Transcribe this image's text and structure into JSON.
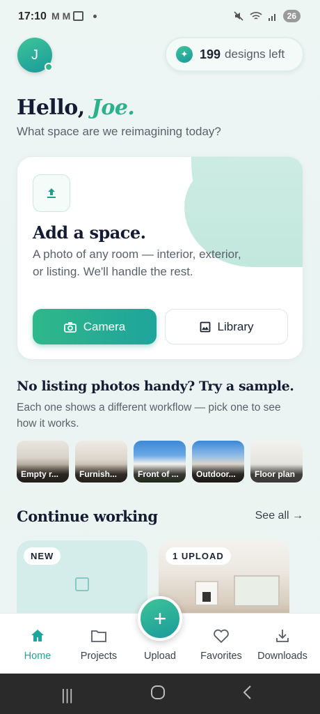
{
  "status_bar": {
    "time": "17:10",
    "battery": "26"
  },
  "header": {
    "avatar_initial": "J",
    "designs_count": "199",
    "designs_label": "designs left"
  },
  "greeting": {
    "hello": "Hello,",
    "name": "Joe.",
    "subtitle": "What space are we reimagining today?"
  },
  "add_space": {
    "title": "Add a space.",
    "description": "A photo of any room — interior, exterior, or listing. We'll handle the rest.",
    "camera_label": "Camera",
    "library_label": "Library"
  },
  "samples": {
    "title": "No listing photos handy? Try a sample.",
    "description": "Each one shows a different workflow — pick one to see how it works.",
    "items": [
      {
        "label": "Empty r..."
      },
      {
        "label": "Furnish..."
      },
      {
        "label": "Front of ..."
      },
      {
        "label": "Outdoor..."
      },
      {
        "label": "Floor plan"
      }
    ]
  },
  "continue_working": {
    "title": "Continue working",
    "see_all": "See all →",
    "projects": [
      {
        "badge": "NEW"
      },
      {
        "badge": "1 UPLOAD"
      }
    ]
  },
  "bottom_nav": {
    "items": [
      {
        "label": "Home",
        "icon": "home-icon"
      },
      {
        "label": "Projects",
        "icon": "folder-icon"
      },
      {
        "label": "Upload",
        "icon": "plus-icon"
      },
      {
        "label": "Favorites",
        "icon": "heart-icon"
      },
      {
        "label": "Downloads",
        "icon": "download-icon"
      }
    ],
    "active": "Home"
  },
  "colors": {
    "accent": "#1ea49b",
    "accent_light": "#2fb889",
    "heading": "#141c33"
  }
}
